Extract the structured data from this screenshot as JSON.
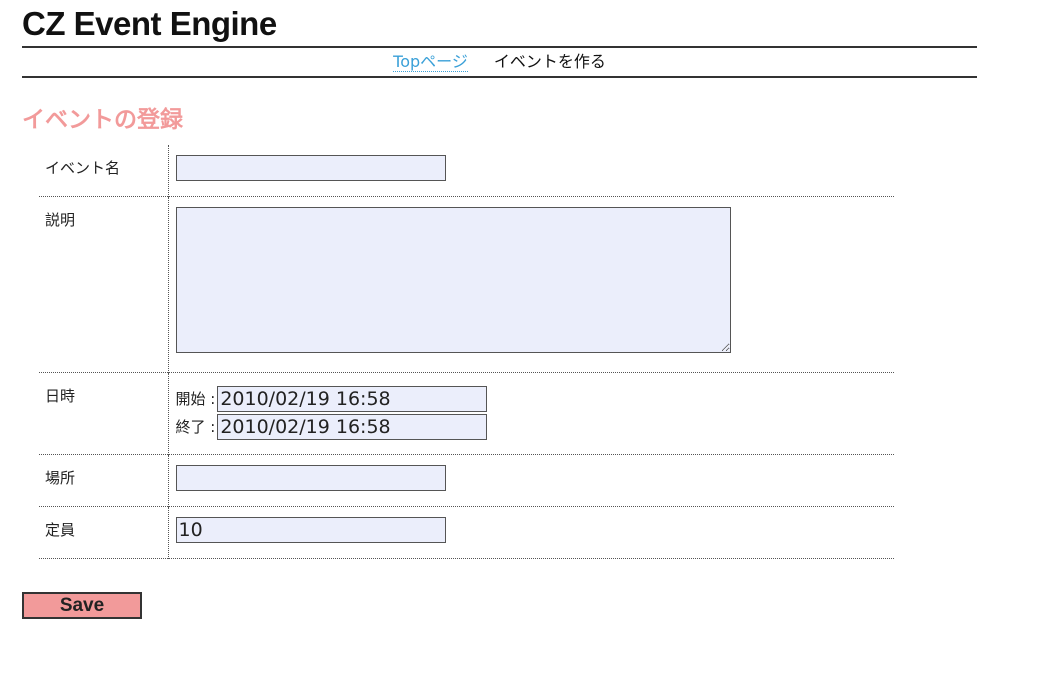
{
  "site": {
    "title": "CZ Event Engine"
  },
  "nav": {
    "top_link": "Topページ",
    "current": "イベントを作る"
  },
  "section": {
    "title": "イベントの登録"
  },
  "form": {
    "name_label": "イベント名",
    "name_value": "",
    "desc_label": "説明",
    "desc_value": "",
    "date_label": "日時",
    "start_label": "開始 :",
    "start_value": "2010/02/19 16:58",
    "end_label": "終了 :",
    "end_value": "2010/02/19 16:58",
    "place_label": "場所",
    "place_value": "",
    "capacity_label": "定員",
    "capacity_value": "10",
    "save_label": "Save"
  },
  "colors": {
    "accent": "#f29a9a",
    "link": "#3aa0d8",
    "input_bg": "#ebeefb"
  }
}
